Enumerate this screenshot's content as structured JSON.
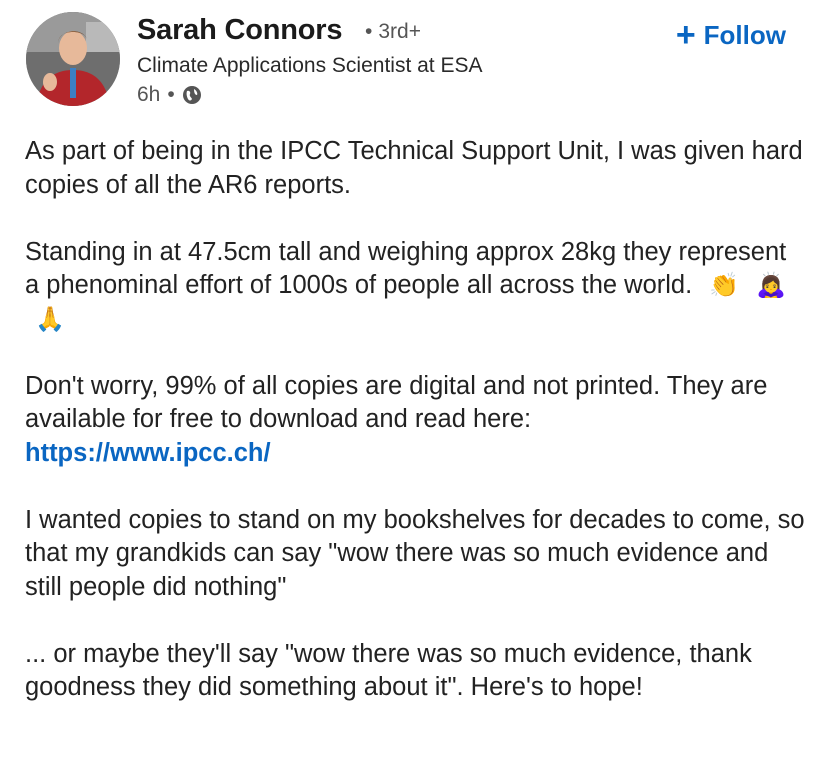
{
  "author": {
    "name": "Sarah Connors",
    "degree": "3rd+",
    "headline": "Climate Applications Scientist at ESA",
    "time_ago": "6h",
    "visibility_icon": "globe-icon"
  },
  "follow": {
    "label": "Follow",
    "icon": "plus-icon",
    "color": "#0a66c2"
  },
  "post": {
    "p1": "As part of being in the IPCC Technical Support Unit, I was given hard copies of all the AR6 reports.",
    "p2": "Standing in at 47.5cm tall and weighing approx 28kg they represent a phenominal effort of 1000s of people all across the world.",
    "p2_emojis": [
      "👏",
      "🙇‍♀️",
      "🙏"
    ],
    "p3": "Don't worry, 99% of all copies are digital and not printed. They are available for free to download and read here:",
    "link": "https://www.ipcc.ch/",
    "p4": "I wanted copies to stand on my bookshelves for decades to come, so that my grandkids can say \"wow there was so much evidence and still people did nothing\"",
    "p5": "... or maybe they'll say \"wow there was so much evidence, thank goodness they did something about it\". Here's to hope!"
  }
}
